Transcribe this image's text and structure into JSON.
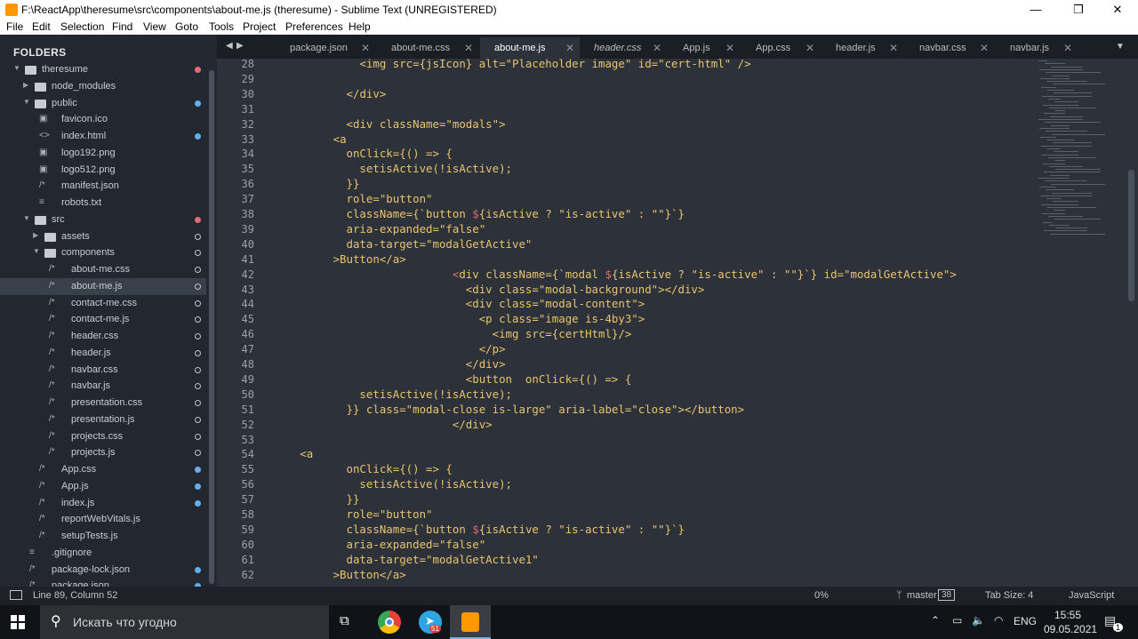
{
  "window": {
    "title": "F:\\ReactApp\\theresume\\src\\components\\about-me.js (theresume) - Sublime Text (UNREGISTERED)",
    "controls": {
      "minimize": "—",
      "maximize": "❐",
      "close": "✕"
    }
  },
  "menu": [
    "File",
    "Edit",
    "Selection",
    "Find",
    "View",
    "Goto",
    "Tools",
    "Project",
    "Preferences",
    "Help"
  ],
  "sidebar": {
    "heading": "FOLDERS",
    "items": [
      {
        "label": "theresume",
        "kind": "folder-open",
        "indent": 0,
        "dot": "#e06c75"
      },
      {
        "label": "node_modules",
        "kind": "folder-closed",
        "indent": 1,
        "dot": ""
      },
      {
        "label": "public",
        "kind": "folder-open",
        "indent": 1,
        "dot": "#61afef"
      },
      {
        "label": "favicon.ico",
        "kind": "image",
        "indent": 2,
        "dot": ""
      },
      {
        "label": "index.html",
        "kind": "html",
        "indent": 2,
        "dot": "#61afef"
      },
      {
        "label": "logo192.png",
        "kind": "image",
        "indent": 2,
        "dot": ""
      },
      {
        "label": "logo512.png",
        "kind": "image",
        "indent": 2,
        "dot": ""
      },
      {
        "label": "manifest.json",
        "kind": "comment",
        "indent": 2,
        "dot": ""
      },
      {
        "label": "robots.txt",
        "kind": "text",
        "indent": 2,
        "dot": ""
      },
      {
        "label": "src",
        "kind": "folder-open",
        "indent": 1,
        "dot": "#e06c75"
      },
      {
        "label": "assets",
        "kind": "folder-closed",
        "indent": 2,
        "dot": "ring"
      },
      {
        "label": "components",
        "kind": "folder-open",
        "indent": 2,
        "dot": "ring"
      },
      {
        "label": "about-me.css",
        "kind": "comment",
        "indent": 3,
        "dot": "ring"
      },
      {
        "label": "about-me.js",
        "kind": "comment",
        "indent": 3,
        "dot": "ring",
        "selected": true
      },
      {
        "label": "contact-me.css",
        "kind": "comment",
        "indent": 3,
        "dot": "ring"
      },
      {
        "label": "contact-me.js",
        "kind": "comment",
        "indent": 3,
        "dot": "ring"
      },
      {
        "label": "header.css",
        "kind": "comment",
        "indent": 3,
        "dot": "ring"
      },
      {
        "label": "header.js",
        "kind": "comment",
        "indent": 3,
        "dot": "ring"
      },
      {
        "label": "navbar.css",
        "kind": "comment",
        "indent": 3,
        "dot": "ring"
      },
      {
        "label": "navbar.js",
        "kind": "comment",
        "indent": 3,
        "dot": "ring"
      },
      {
        "label": "presentation.css",
        "kind": "comment",
        "indent": 3,
        "dot": "ring"
      },
      {
        "label": "presentation.js",
        "kind": "comment",
        "indent": 3,
        "dot": "ring"
      },
      {
        "label": "projects.css",
        "kind": "comment",
        "indent": 3,
        "dot": "ring"
      },
      {
        "label": "projects.js",
        "kind": "comment",
        "indent": 3,
        "dot": "ring"
      },
      {
        "label": "App.css",
        "kind": "comment",
        "indent": 2,
        "dot": "#61afef"
      },
      {
        "label": "App.js",
        "kind": "comment",
        "indent": 2,
        "dot": "#61afef"
      },
      {
        "label": "index.js",
        "kind": "comment",
        "indent": 2,
        "dot": "#61afef"
      },
      {
        "label": "reportWebVitals.js",
        "kind": "comment",
        "indent": 2,
        "dot": ""
      },
      {
        "label": "setupTests.js",
        "kind": "comment",
        "indent": 2,
        "dot": ""
      },
      {
        "label": ".gitignore",
        "kind": "text",
        "indent": 1,
        "dot": ""
      },
      {
        "label": "package-lock.json",
        "kind": "comment",
        "indent": 1,
        "dot": "#61afef"
      },
      {
        "label": "package.json",
        "kind": "comment",
        "indent": 1,
        "dot": "#61afef"
      }
    ]
  },
  "tabs": [
    {
      "label": "package.json",
      "italic": false,
      "active": false
    },
    {
      "label": "about-me.css",
      "italic": false,
      "active": false
    },
    {
      "label": "about-me.js",
      "italic": false,
      "active": true
    },
    {
      "label": "header.css",
      "italic": true,
      "active": false
    },
    {
      "label": "App.js",
      "italic": false,
      "active": false
    },
    {
      "label": "App.css",
      "italic": false,
      "active": false
    },
    {
      "label": "header.js",
      "italic": false,
      "active": false
    },
    {
      "label": "navbar.css",
      "italic": false,
      "active": false
    },
    {
      "label": "navbar.js",
      "italic": false,
      "active": false
    }
  ],
  "tab_nav": {
    "prev": "◀",
    "next": "▶",
    "more": "▼"
  },
  "editor": {
    "lines": [
      {
        "n": "28",
        "tokens": [
          [
            "              ",
            ""
          ],
          [
            "<img src={jsIcon} alt=\"Placeholder image\" id=\"cert-html\" />",
            "t"
          ]
        ]
      },
      {
        "n": "29",
        "tokens": [
          [
            "",
            ""
          ]
        ]
      },
      {
        "n": "30",
        "tokens": [
          [
            "            ",
            ""
          ],
          [
            "</div>",
            "t"
          ]
        ]
      },
      {
        "n": "31",
        "tokens": [
          [
            "",
            ""
          ]
        ]
      },
      {
        "n": "32",
        "tokens": [
          [
            "            ",
            ""
          ],
          [
            "<div className=\"modals\">",
            "t"
          ]
        ]
      },
      {
        "n": "33",
        "tokens": [
          [
            "          ",
            ""
          ],
          [
            "<a",
            "t"
          ]
        ]
      },
      {
        "n": "34",
        "tokens": [
          [
            "            onClick={() => {",
            "t"
          ]
        ]
      },
      {
        "n": "35",
        "tokens": [
          [
            "              setisActive(!isActive);",
            "t"
          ]
        ]
      },
      {
        "n": "36",
        "tokens": [
          [
            "            }}",
            "t"
          ]
        ]
      },
      {
        "n": "37",
        "tokens": [
          [
            "            role=\"button\"",
            "t"
          ]
        ]
      },
      {
        "n": "38",
        "tokens": [
          [
            "            className={`button ",
            "t"
          ],
          [
            "$",
            "p"
          ],
          [
            "{isActive ? \"is-active\" : \"\"}`}",
            "t"
          ]
        ]
      },
      {
        "n": "39",
        "tokens": [
          [
            "            aria-expanded=\"false\"",
            "t"
          ]
        ]
      },
      {
        "n": "40",
        "tokens": [
          [
            "            data-target=\"modalGetActive\"",
            "t"
          ]
        ]
      },
      {
        "n": "41",
        "tokens": [
          [
            "          >Button</a>",
            "t"
          ]
        ]
      },
      {
        "n": "42",
        "tokens": [
          [
            "                            ",
            ""
          ],
          [
            "<",
            "p"
          ],
          [
            "div className={`modal ",
            "t"
          ],
          [
            "$",
            "p"
          ],
          [
            "{isActive ? \"is-active\" : \"\"}`} id=\"modalGetActive\">",
            "t"
          ]
        ]
      },
      {
        "n": "43",
        "tokens": [
          [
            "                              <div class=\"modal-background\"></div>",
            "t"
          ]
        ]
      },
      {
        "n": "44",
        "tokens": [
          [
            "                              <div class=\"modal-content\">",
            "t"
          ]
        ]
      },
      {
        "n": "45",
        "tokens": [
          [
            "                                <p class=\"image is-4by3\">",
            "t"
          ]
        ]
      },
      {
        "n": "46",
        "tokens": [
          [
            "                                  <img src={certHtml}/>",
            "t"
          ]
        ]
      },
      {
        "n": "47",
        "tokens": [
          [
            "                                </p>",
            "t"
          ]
        ]
      },
      {
        "n": "48",
        "tokens": [
          [
            "                              </div>",
            "t"
          ]
        ]
      },
      {
        "n": "49",
        "tokens": [
          [
            "                              <button  onClick={() => {",
            "t"
          ]
        ]
      },
      {
        "n": "50",
        "tokens": [
          [
            "              setisActive(!isActive);",
            "t"
          ]
        ]
      },
      {
        "n": "51",
        "tokens": [
          [
            "            }} class=\"modal-close is-large\" aria-label=\"close\"></button>",
            "t"
          ]
        ]
      },
      {
        "n": "52",
        "tokens": [
          [
            "                            </div>",
            "t"
          ]
        ]
      },
      {
        "n": "53",
        "tokens": [
          [
            "",
            ""
          ]
        ]
      },
      {
        "n": "54",
        "tokens": [
          [
            "     <a",
            "t"
          ]
        ]
      },
      {
        "n": "55",
        "tokens": [
          [
            "            onClick={() => {",
            "t"
          ]
        ]
      },
      {
        "n": "56",
        "tokens": [
          [
            "              setisActive(!isActive);",
            "t"
          ]
        ]
      },
      {
        "n": "57",
        "tokens": [
          [
            "            }}",
            "t"
          ]
        ]
      },
      {
        "n": "58",
        "tokens": [
          [
            "            role=\"button\"",
            "t"
          ]
        ]
      },
      {
        "n": "59",
        "tokens": [
          [
            "            className={`button ",
            "t"
          ],
          [
            "$",
            "p"
          ],
          [
            "{isActive ? \"is-active\" : \"\"}`}",
            "t"
          ]
        ]
      },
      {
        "n": "60",
        "tokens": [
          [
            "            aria-expanded=\"false\"",
            "t"
          ]
        ]
      },
      {
        "n": "61",
        "tokens": [
          [
            "            data-target=\"modalGetActive1\"",
            "t"
          ]
        ]
      },
      {
        "n": "62",
        "tokens": [
          [
            "          >Button</a>",
            "t"
          ]
        ]
      }
    ],
    "text_color": "#e6e6e6",
    "punct_color": "#e06c75",
    "tag_color": "#e8c46c"
  },
  "status": {
    "position": "Line 89, Column 52",
    "percent": "0%",
    "branch": "master",
    "branch_count": "38",
    "tab_size": "Tab Size: 4",
    "syntax": "JavaScript"
  },
  "taskbar": {
    "search_placeholder": "Искать что угодно",
    "telegram_badge": "51",
    "lang": "ENG",
    "time": "15:55",
    "date": "09.05.2021",
    "notify_count": "1"
  },
  "colors": {
    "accent_blue": "#61afef",
    "accent_red": "#e06c75"
  }
}
